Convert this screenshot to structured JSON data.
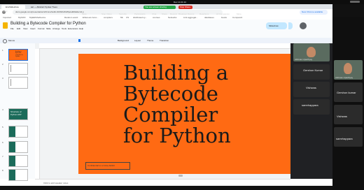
{
  "desktop": {
    "clock": "Dec 14 21:14"
  },
  "meet": {
    "controls": [
      "Mute",
      "Stop Video",
      "Security",
      "Participants",
      "Chat",
      "Share",
      "Record",
      "Breakout Rooms",
      "Reactions",
      "AI Companion",
      "More"
    ],
    "share_badge": "You are screen sharing",
    "stop_share": "Stop Share",
    "view_label": "View",
    "update_label": "New Chrome available"
  },
  "browser": {
    "tabs": [
      "EnvSlideshow",
      "ast — Abstract Syntax Trees"
    ],
    "url": "docs.google.com/presentation/d/1mnwVe0nxDcW0uSVi8p/edit#slide=id.p",
    "bookmarks": [
      "Imported",
      "MySOD",
      "MyEEStheDevice",
      "Random weird",
      "Ethereum Acco...",
      "compilers",
      "ML",
      "CS",
      "distributed sy...",
      "courses",
      "Networks",
      "Link aggregat...",
      "databases",
      "books",
      "Compexcit"
    ]
  },
  "doc": {
    "title": "Building a Bytecode Compiler for Python",
    "menu": [
      "File",
      "Edit",
      "View",
      "Insert",
      "Format",
      "Slide",
      "Arrange",
      "Tools",
      "Extensions",
      "Help"
    ],
    "slideshow": "Slideshow",
    "toolbar": [
      "Menus",
      "Background",
      "Layout",
      "Theme",
      "Transition"
    ],
    "notes_placeholder": "Click to add speaker notes"
  },
  "slide": {
    "title_lines": [
      "Building a",
      "Bytecode",
      "Compiler",
      "for Python"
    ],
    "footer": "Confidential to a Coke-Addict"
  },
  "thumbnails": [
    {
      "num": "1",
      "kind": "orange",
      "text": "Building a Bytecode Compiler for Python"
    },
    {
      "num": "2",
      "kind": "white",
      "text": ""
    },
    {
      "num": "3",
      "kind": "white",
      "text": ""
    },
    {
      "num": "4",
      "kind": "teal",
      "text": "Structure of Python AST"
    },
    {
      "num": "5",
      "kind": "teal",
      "text": ""
    },
    {
      "num": "6",
      "kind": "teal",
      "text": ""
    },
    {
      "num": "7",
      "kind": "teal",
      "text": ""
    },
    {
      "num": "8",
      "kind": "teal",
      "text": ""
    }
  ],
  "participants_panel": [
    {
      "name": "Abhinav Upadhyay",
      "kind": "video"
    },
    {
      "name": "Gershon Kumar",
      "kind": "name"
    },
    {
      "name": "Vishwas",
      "kind": "name"
    },
    {
      "name": "samrhappara",
      "kind": "name"
    }
  ],
  "right_tiles": [
    {
      "name": "Abhinav Upadhyay",
      "kind": "video"
    },
    {
      "name": "Gershon kumar",
      "kind": "name"
    },
    {
      "name": "Vishwas",
      "kind": "name"
    },
    {
      "name": "samrhappara",
      "kind": "name"
    }
  ],
  "colors": {
    "slide_bg": "#ff6a13",
    "slide_text": "#1a1a1a",
    "teal": "#1b6b5a",
    "accent": "#1a73e8"
  }
}
